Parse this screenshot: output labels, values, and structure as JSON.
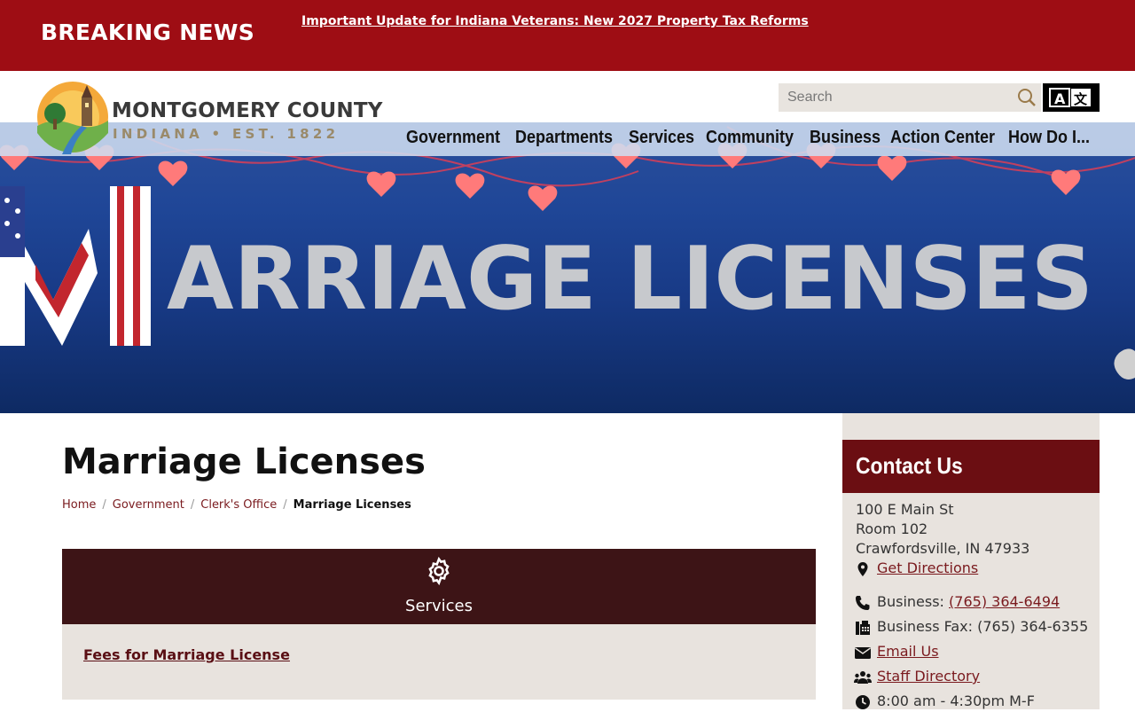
{
  "breaking": {
    "label": "BREAKING NEWS",
    "headline": "Important Update for Indiana Veterans: New 2027 Property Tax Reforms"
  },
  "logo": {
    "title": "MONTGOMERY COUNTY",
    "subtitle": "INDIANA • EST. 1822"
  },
  "search": {
    "placeholder": "Search",
    "icon": "search-icon"
  },
  "translate": {
    "icon": "translate-icon"
  },
  "nav": {
    "items": [
      "Government",
      "Departments",
      "Services",
      "Community",
      "Business",
      "Action Center",
      "How Do I..."
    ]
  },
  "hero": {
    "text": "MARRIAGE LICENSES"
  },
  "page": {
    "title": "Marriage Licenses"
  },
  "breadcrumb": {
    "items": [
      "Home",
      "Government",
      "Clerk's Office"
    ],
    "current": "Marriage Licenses"
  },
  "services": {
    "icon": "gear-icon",
    "title": "Services",
    "links": [
      "Fees for Marriage License"
    ]
  },
  "contact": {
    "title": "Contact Us",
    "address": [
      "100 E Main St",
      "Room 102",
      "Crawfordsville, IN 47933"
    ],
    "directions": "Get Directions",
    "business_label": "Business: ",
    "business_phone": "(765) 364-6494",
    "fax": "Business Fax: (765) 364-6355",
    "email": "Email Us",
    "staff": "Staff Directory",
    "hours": "8:00 am - 4:30pm M-F"
  },
  "colors": {
    "brand_red": "#9e0d14",
    "dark_maroon": "#3d1416",
    "contact_red": "#6b0e12",
    "panel_beige": "#e8e3de",
    "hero_blue": "#1f4697"
  }
}
